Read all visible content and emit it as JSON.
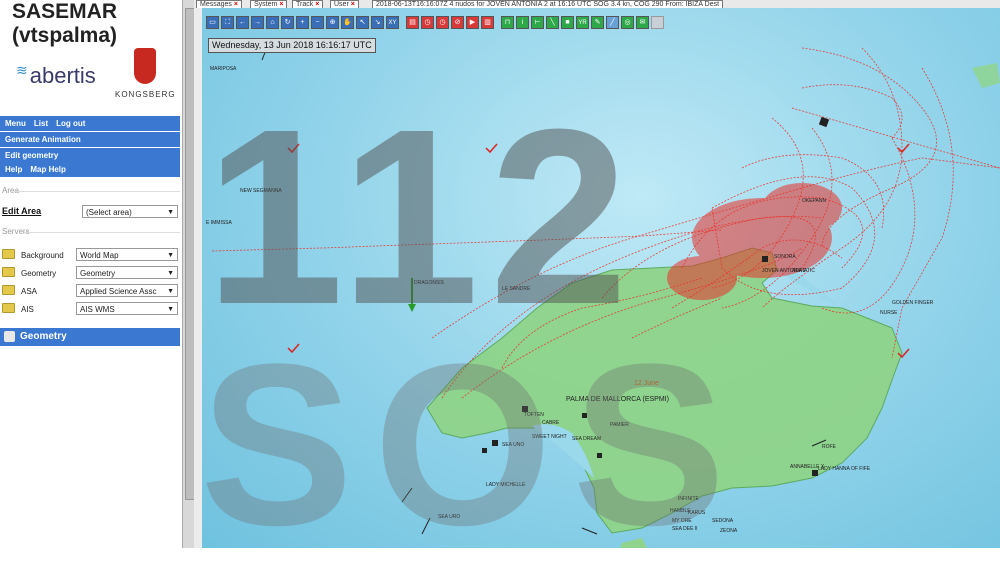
{
  "app": {
    "title_line1": "SASEMAR",
    "title_line2": "(vtspalma)",
    "logo_abertis": "abertis",
    "logo_kongsberg": "KONGSBERG"
  },
  "menu_bars": [
    {
      "items": [
        "Menu",
        "List",
        "Log out"
      ]
    },
    {
      "items": [
        "Generate Animation"
      ]
    },
    {
      "items": [
        "Edit geometry"
      ]
    },
    {
      "items": [
        "Help",
        "Map Help"
      ]
    }
  ],
  "area": {
    "section_label": "Area",
    "edit_area_label": "Edit Area",
    "select_value": "(Select area)"
  },
  "servers": {
    "section_label": "Servers",
    "rows": [
      {
        "label": "Background",
        "value": "World Map"
      },
      {
        "label": "Geometry",
        "value": "Geometry"
      },
      {
        "label": "ASA",
        "value": "Applied Science Assc"
      },
      {
        "label": "AIS",
        "value": "AIS WMS"
      }
    ]
  },
  "geometry_panel": {
    "label": "Geometry"
  },
  "top_tabs": [
    {
      "label": "Messages",
      "closable": true
    },
    {
      "label": "System",
      "closable": true
    },
    {
      "label": "Track",
      "closable": true
    },
    {
      "label": "User",
      "closable": true
    },
    {
      "label": "2018-06-13T16:16:07Z 4 nudos for JOVEN ANTONIA 2 at 16:16 UTC SOG 3.4 kn, COG 290 From: IBIZA Dest",
      "closable": false
    }
  ],
  "map": {
    "datetime": "Wednesday, 13 Jun 2018 16:16:17 UTC",
    "place_labels": [
      "PALMA DE MALLORCA (ESPMI)",
      "12 June"
    ],
    "vessel_labels": [
      "MARIPOSA",
      "NEW SEGMANNA",
      "E IMMISSA",
      "DRAGONSIS",
      "SONORA",
      "ANNABELLE X",
      "LADY HANNA OF FIFE",
      "LADY MICHELLE",
      "SEA URO",
      "SEA UNO",
      "TOFTEN",
      "SEA DREAM",
      "SWEET NIGHT",
      "PAMIER",
      "CABRE",
      "MY ORE",
      "SEA DEE II",
      "INFINITE",
      "SEDONA",
      "HAMBLE",
      "KARUS",
      "ZEONA",
      "GOLDEN FINGER",
      "NURSE",
      "ROFE",
      "JOVEN ANTONIA 2",
      "ADRIATIC",
      "OKEPANN",
      "LE SANDRE"
    ],
    "accent_track": "#e8322a",
    "land": "#8fd48a",
    "sea": "#8fd2e9"
  },
  "watermark": {
    "line1": "112",
    "line2": "SOS"
  }
}
